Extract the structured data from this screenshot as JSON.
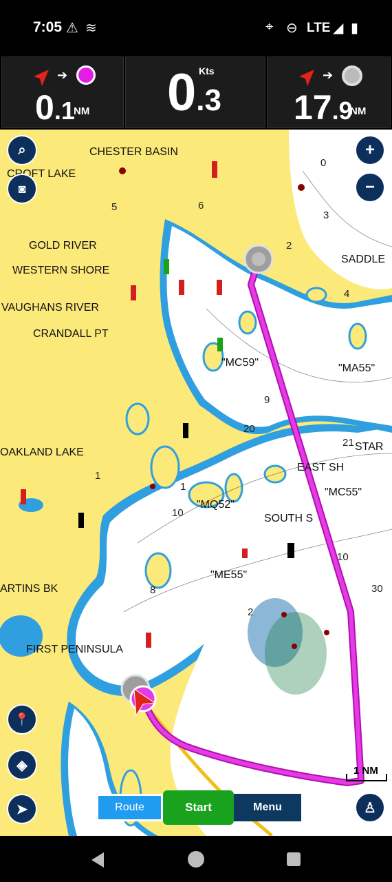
{
  "status": {
    "time": "7:05",
    "network": "LTE",
    "icons": [
      "warning-icon",
      "waves-icon",
      "location-icon",
      "do-not-disturb-icon",
      "signal-icon",
      "battery-icon"
    ]
  },
  "instruments": {
    "left": {
      "whole": "0",
      "frac": ".1",
      "unit": "NM"
    },
    "center": {
      "whole": "0",
      "frac": ".3",
      "unit": "Kts"
    },
    "right": {
      "whole": "17",
      "frac": ".9",
      "unit": "NM"
    }
  },
  "map": {
    "places": [
      "CHESTER BASIN",
      "CROFT LAKE",
      "GOLD RIVER",
      "WESTERN SHORE",
      "VAUGHANS RIVER",
      "CRANDALL PT",
      "OAKLAND LAKE",
      "FIRST PENINSULA",
      "ARTINS BK",
      "SOUTH S",
      "EAST SH",
      "SADDLE",
      "STAR"
    ],
    "buoys": [
      "\"MC59\"",
      "\"MA55\"",
      "\"MC55\"",
      "\"MQ52\"",
      "\"ME55\""
    ],
    "depths": [
      "0",
      "5",
      "6",
      "3",
      "2",
      "9",
      "4",
      "20",
      "21",
      "10",
      "30",
      "1",
      "8"
    ],
    "scale": "1 NM"
  },
  "colors": {
    "land": "#fbe97a",
    "shallow": "#2f9fe0",
    "water": "#ffffff",
    "route": "#d21fd2",
    "track": "#f0c018",
    "panel": "#1c1c1c"
  },
  "controls": {
    "route": "Route",
    "start": "Start",
    "menu": "Menu"
  }
}
